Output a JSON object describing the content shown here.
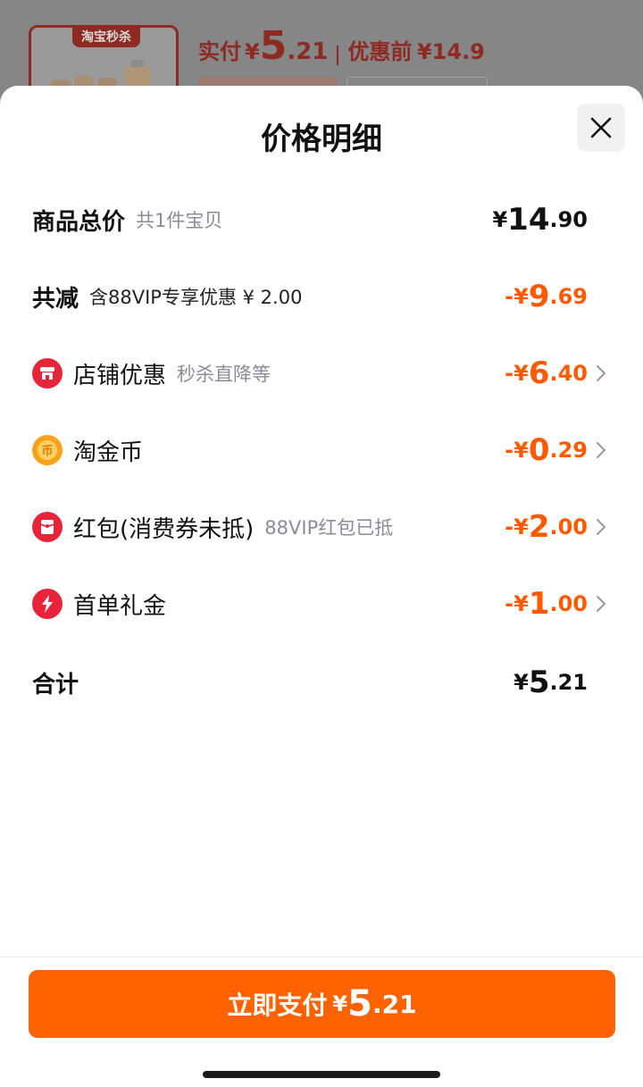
{
  "background": {
    "badge": "淘宝秒杀",
    "price_label": "实付",
    "price_yen": "¥",
    "price_int": "5",
    "price_dec": ".21",
    "original_label": "优惠前",
    "original_price": "¥14.9"
  },
  "sheet": {
    "title": "价格明细",
    "close_icon": "close-icon"
  },
  "rows": {
    "total": {
      "label": "商品总价",
      "sub": "共1件宝贝",
      "yen": "¥",
      "int": "14",
      "dec": ".90"
    },
    "reduce": {
      "label": "共减",
      "sub": "含88VIP专享优惠 ¥ 2.00",
      "yen": "-¥",
      "int": "9",
      "dec": ".69"
    },
    "shop": {
      "icon": "shop-icon",
      "label": "店铺优惠",
      "sub": "秒杀直降等",
      "yen": "-¥",
      "int": "6",
      "dec": ".40"
    },
    "coin": {
      "icon": "coin-icon",
      "label": "淘金币",
      "sub": "",
      "yen": "-¥",
      "int": "0",
      "dec": ".29"
    },
    "redpacket": {
      "icon": "red-packet-icon",
      "label": "红包(消费券未抵)",
      "sub": "88VIP红包已抵",
      "yen": "-¥",
      "int": "2",
      "dec": ".00"
    },
    "firstorder": {
      "icon": "lightning-icon",
      "label": "首单礼金",
      "sub": "",
      "yen": "-¥",
      "int": "1",
      "dec": ".00"
    },
    "sum": {
      "label": "合计",
      "yen": "¥",
      "int": "5",
      "dec": ".21"
    }
  },
  "footer": {
    "pay_label": "立即支付",
    "yen": "¥",
    "int": "5",
    "dec": ".21"
  },
  "colors": {
    "accent": "#ff6200",
    "discount": "#ff5a00",
    "shop_icon": "#e8243a",
    "coin_icon": "#f6a21a",
    "red_packet_icon": "#e8243a",
    "lightning_icon": "#e8243a"
  }
}
